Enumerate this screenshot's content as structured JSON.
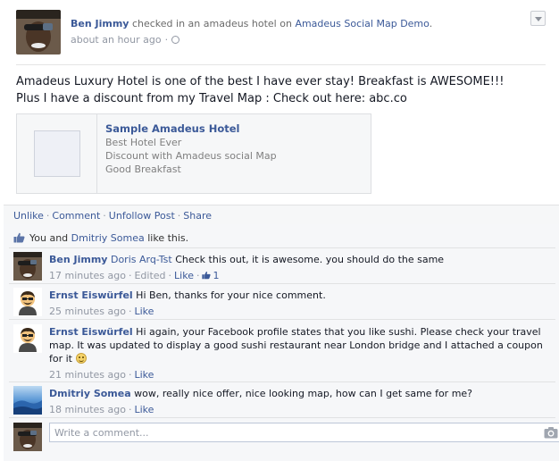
{
  "post": {
    "author": "Ben Jimmy",
    "action_text": " checked in an amadeus hotel on ",
    "app_name": "Amadeus Social Map Demo",
    "app_suffix": ".",
    "time": "about an hour ago",
    "text_line1": "Amadeus Luxury Hotel is one of the best I have ever stay! Breakfast is AWESOME!!!",
    "text_line2": "Plus I have a discount from my Travel Map : Check out here: abc.co"
  },
  "attachment": {
    "title": "Sample Amadeus Hotel",
    "lines": [
      "Best Hotel Ever",
      "Discount with Amadeus social Map",
      "Good Breakfast"
    ]
  },
  "actions": {
    "unlike": "Unlike",
    "comment": "Comment",
    "unfollow": "Unfollow Post",
    "share": "Share",
    "sep": "·"
  },
  "likes": {
    "prefix": "You and ",
    "other": "Dmitriy Somea",
    "suffix": " like this."
  },
  "comments": [
    {
      "author": "Ben Jimmy",
      "tag": "Doris Arq-Tst",
      "text": " Check this out, it is awesome. you should do the same",
      "time": "17 minutes ago",
      "edited": "Edited",
      "like_label": "Like",
      "like_count": "1"
    },
    {
      "author": "Ernst Eiswürfel",
      "text": " Hi Ben, thanks for your nice comment.",
      "time": "25 minutes ago",
      "like_label": "Like"
    },
    {
      "author": "Ernst Eiswürfel",
      "text": " Hi again, your Facebook profile states that you like sushi. Please check your travel map. It was updated to display a good sushi restaurant near London bridge and I attached a coupon for it ",
      "time": "21 minutes ago",
      "like_label": "Like"
    },
    {
      "author": "Dmitriy Somea",
      "text": " wow, really nice offer, nice looking map, how can I get same for me?",
      "time": "18 minutes ago",
      "like_label": "Like"
    }
  ],
  "composer": {
    "placeholder": "Write a comment..."
  },
  "colors": {
    "link": "#3b5998",
    "muted": "#9197a3",
    "ufi_bg": "#f6f7f9"
  },
  "icons": [
    "chevron-down-icon",
    "globe-icon",
    "thumbs-up-icon",
    "smiley-icon",
    "camera-icon"
  ]
}
